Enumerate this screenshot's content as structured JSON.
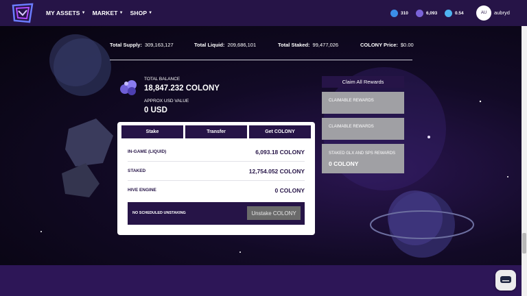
{
  "nav": {
    "logo_icon": "colony-logo-icon",
    "menu": [
      {
        "label": "MY ASSETS"
      },
      {
        "label": "MARKET"
      },
      {
        "label": "SHOP"
      }
    ],
    "stats": [
      {
        "icon": "spark-icon",
        "value": "310",
        "color": "#3b8ee8"
      },
      {
        "icon": "colony-token-icon",
        "value": "6,093",
        "color": "#7a63d8"
      },
      {
        "icon": "rocket-icon",
        "value": "0.54",
        "color": "#4fb4f0"
      }
    ],
    "avatar_initials": "AU",
    "username": "aubryd"
  },
  "totals": {
    "supply_label": "Total Supply:",
    "supply_value": "309,163,127",
    "liquid_label": "Total Liquid:",
    "liquid_value": "209,686,101",
    "staked_label": "Total Staked:",
    "staked_value": "99,477,026",
    "price_label": "COLONY Price:",
    "price_value": "$0.00"
  },
  "balance": {
    "total_label": "TOTAL BALANCE",
    "total_value": "18,847.232 COLONY",
    "usd_label": "APPROX USD VALUE",
    "usd_value": "0 USD"
  },
  "card": {
    "tabs": [
      {
        "label": "Stake"
      },
      {
        "label": "Transfer"
      },
      {
        "label": "Get COLONY"
      }
    ],
    "rows": [
      {
        "label": "IN-GAME (LIQUID)",
        "value": "6,093.18 COLONY"
      },
      {
        "label": "STAKED",
        "value": "12,754.052 COLONY"
      },
      {
        "label": "HIVE ENGINE",
        "value": "0 COLONY"
      }
    ],
    "unstake_status": "NO SCHEDULED UNSTAKING",
    "unstake_button": "Unstake COLONY"
  },
  "rewards": {
    "claim_all": "Claim All Rewards",
    "boxes": [
      {
        "label": "CLAIMABLE REWARDS"
      },
      {
        "label": "CLAIMABLE REWARDS"
      },
      {
        "label": "STAKED GLX AND SPS REWARDS",
        "value": "0 COLONY"
      }
    ]
  },
  "colors": {
    "nav_bg": "#261447",
    "accent": "#261447",
    "page_bg": "#2d1657",
    "reward_box": "#a0a0a4"
  },
  "chat": {
    "icon": "chat-bubble-icon"
  }
}
